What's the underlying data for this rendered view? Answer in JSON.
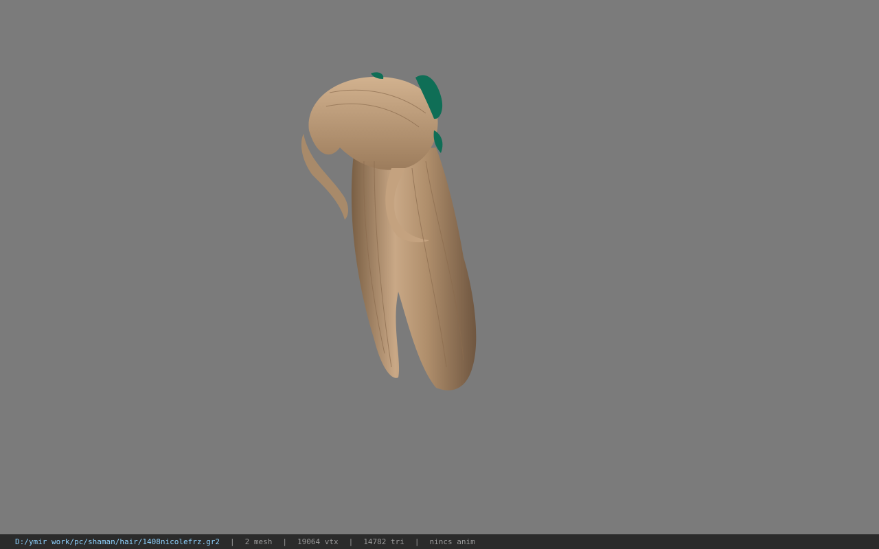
{
  "viewport": {
    "model_icon": "hair-mesh",
    "colors": {
      "background": "#7b7b7b",
      "hair": "#b0906a",
      "ribbon": "#0f6e56"
    }
  },
  "statusbar": {
    "file_path": "D:/ymir work/pc/shaman/hair/1408nicolefrz.gr2",
    "separator": "|",
    "mesh_count": "2 mesh",
    "vertex_count": "19064 vtx",
    "triangle_count": "14782 tri",
    "anim_status": "nincs anim"
  }
}
